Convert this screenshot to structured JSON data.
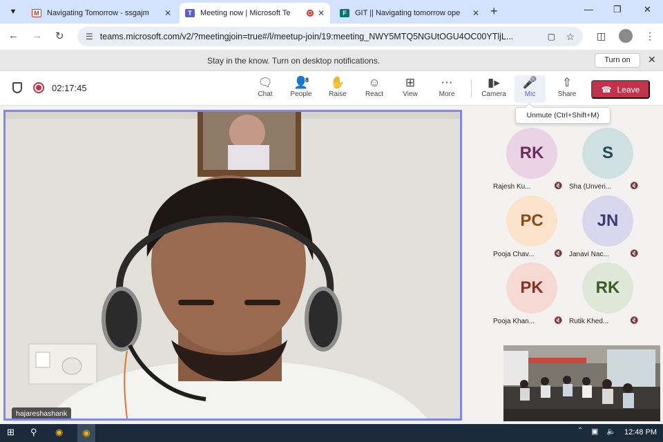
{
  "browser": {
    "tabs": [
      {
        "title": "Navigating Tomorrow - ssgajm",
        "favicon": "gmail-icon",
        "active": false
      },
      {
        "title": "Meeting now | Microsoft Te",
        "favicon": "teams-icon",
        "active": true,
        "recording": true
      },
      {
        "title": "GIT || Navigating tomorrow ope",
        "favicon": "forms-icon",
        "active": false
      }
    ],
    "url": "teams.microsoft.com/v2/?meetingjoin=true#/l/meetup-join/19:meeting_NWY5MTQ5NGUtOGU4OC00YTljL..."
  },
  "notification": {
    "message": "Stay in the know. Turn on desktop notifications.",
    "action_label": "Turn on"
  },
  "meeting": {
    "duration": "02:17:45",
    "controls": [
      {
        "label": "Chat",
        "icon": "chat-icon"
      },
      {
        "label": "People",
        "icon": "people-icon",
        "count": "8"
      },
      {
        "label": "Raise",
        "icon": "raise-hand-icon"
      },
      {
        "label": "React",
        "icon": "react-icon"
      },
      {
        "label": "View",
        "icon": "view-icon"
      },
      {
        "label": "More",
        "icon": "more-icon"
      },
      {
        "label": "Camera",
        "icon": "camera-icon"
      },
      {
        "label": "Mic",
        "icon": "mic-off-icon"
      },
      {
        "label": "Share",
        "icon": "share-icon"
      }
    ],
    "leave_label": "Leave",
    "tooltip": "Unmute (Ctrl+Shift+M)",
    "main_video_name": "hajareshashank"
  },
  "participants": [
    {
      "initials": "RK",
      "name": "Rajesh Ku...",
      "bg": "#e9d3e4",
      "fg": "#6b2e5c"
    },
    {
      "initials": "S",
      "name": "Sha (Unveri...",
      "bg": "#cfe0e3",
      "fg": "#1f4a52"
    },
    {
      "initials": "PC",
      "name": "Pooja Chav...",
      "bg": "#fbe3cc",
      "fg": "#8a4a10"
    },
    {
      "initials": "JN",
      "name": "Janavi Nac...",
      "bg": "#d9d7ee",
      "fg": "#3b3a75"
    },
    {
      "initials": "PK",
      "name": "Pooja Khan...",
      "bg": "#f7d9d4",
      "fg": "#8a2f22"
    },
    {
      "initials": "RK",
      "name": "Rutik Khed...",
      "bg": "#dfe8d7",
      "fg": "#3b5a26"
    }
  ],
  "taskbar": {
    "time": "12:48 PM"
  },
  "colors": {
    "teams_accent": "#5b5fc7",
    "leave_red": "#c4314b",
    "video_border": "#7f85f5"
  }
}
